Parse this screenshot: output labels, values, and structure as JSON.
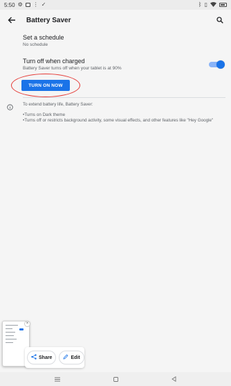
{
  "status_bar": {
    "time": "5:50",
    "icons_left": [
      "gear-icon",
      "screen-icon",
      "dots-icon",
      "check-icon"
    ],
    "icons_right": [
      "bluetooth-icon",
      "vibrate-icon",
      "wifi-icon",
      "battery-icon"
    ]
  },
  "app_bar": {
    "title": "Battery Saver",
    "back_icon": "arrow-left-icon",
    "search_icon": "search-icon"
  },
  "settings": {
    "schedule": {
      "title": "Set a schedule",
      "subtitle": "No schedule"
    },
    "turn_off": {
      "title": "Turn off when charged",
      "subtitle": "Battery Saver turns off when your tablet is at 90%",
      "toggle_on": true
    },
    "turn_on_button": "TURN ON NOW"
  },
  "info": {
    "intro": "To extend battery life, Battery Saver:",
    "bullet1": "•Turns on Dark theme",
    "bullet2": "•Turns off or restricts background activity, some visual effects, and other features like \"Hey Google\""
  },
  "screenshot_overlay": {
    "share_label": "Share",
    "edit_label": "Edit",
    "close_label": "×"
  },
  "colors": {
    "accent": "#1a73e8",
    "annotation": "#e53935"
  }
}
